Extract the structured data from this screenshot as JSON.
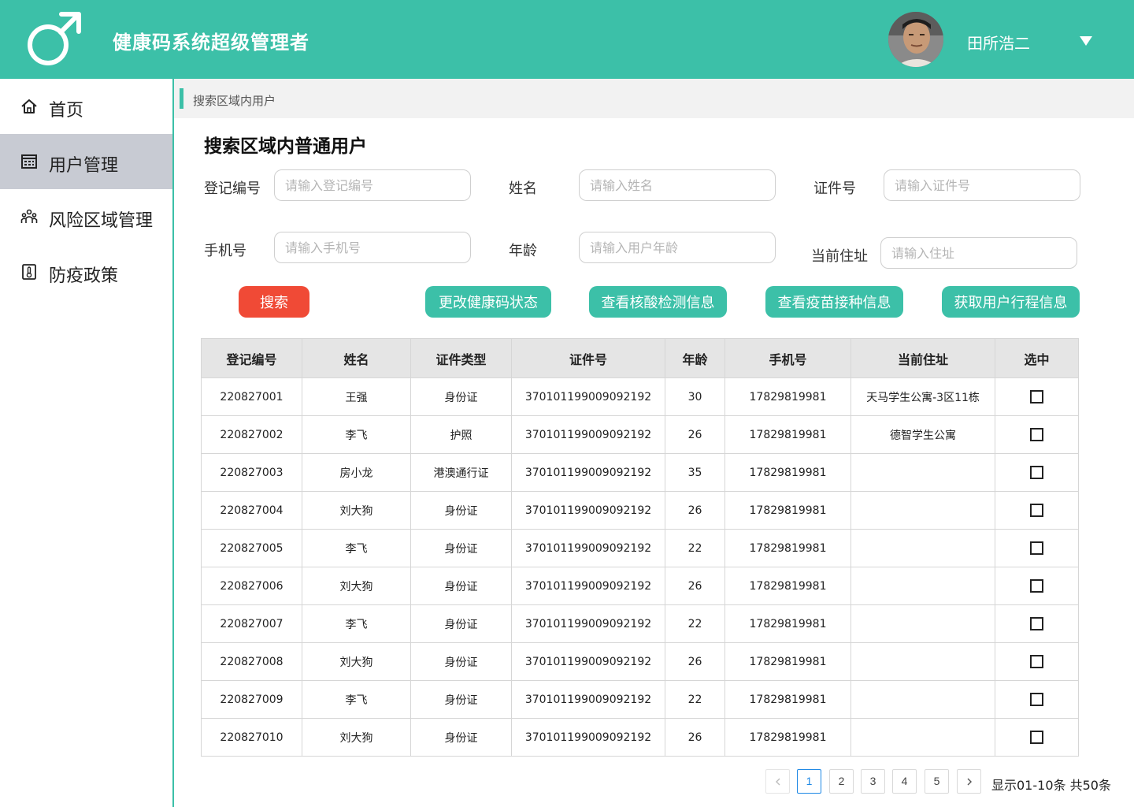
{
  "header": {
    "app_title": "健康码系统超级管理者",
    "user_name": "田所浩二",
    "logo_icon": "male-symbol-icon",
    "dropdown_icon": "caret-down-icon",
    "accent_color": "#3cc0a8"
  },
  "sidebar": {
    "items": [
      {
        "label": "首页",
        "icon": "home-icon",
        "active": false
      },
      {
        "label": "用户管理",
        "icon": "calendar-grid-icon",
        "active": true
      },
      {
        "label": "风险区域管理",
        "icon": "people-group-icon",
        "active": false
      },
      {
        "label": "防疫政策",
        "icon": "thermometer-icon",
        "active": false
      }
    ]
  },
  "breadcrumb": {
    "text": "搜索区域内用户"
  },
  "main": {
    "title": "搜索区域内普通用户",
    "form": {
      "reg_no": {
        "label": "登记编号",
        "placeholder": "请输入登记编号"
      },
      "name": {
        "label": "姓名",
        "placeholder": "请输入姓名"
      },
      "id_no": {
        "label": "证件号",
        "placeholder": "请输入证件号"
      },
      "phone": {
        "label": "手机号",
        "placeholder": "请输入手机号"
      },
      "age": {
        "label": "年龄",
        "placeholder": "请输入用户年龄"
      },
      "address": {
        "label": "当前住址",
        "placeholder": "请输入住址"
      }
    },
    "buttons": {
      "search": "搜索",
      "change_code": "更改健康码状态",
      "nucleic": "查看核酸检测信息",
      "vaccine": "查看疫苗接种信息",
      "itinerary": "获取用户行程信息"
    },
    "table": {
      "columns": [
        "登记编号",
        "姓名",
        "证件类型",
        "证件号",
        "年龄",
        "手机号",
        "当前住址",
        "选中"
      ],
      "rows": [
        {
          "reg": "220827001",
          "name": "王强",
          "type": "身份证",
          "id": "370101199009092192",
          "age": "30",
          "phone": "17829819981",
          "addr": "天马学生公寓-3区11栋"
        },
        {
          "reg": "220827002",
          "name": "李飞",
          "type": "护照",
          "id": "370101199009092192",
          "age": "26",
          "phone": "17829819981",
          "addr": "德智学生公寓"
        },
        {
          "reg": "220827003",
          "name": "房小龙",
          "type": "港澳通行证",
          "id": "370101199009092192",
          "age": "35",
          "phone": "17829819981",
          "addr": ""
        },
        {
          "reg": "220827004",
          "name": "刘大狗",
          "type": "身份证",
          "id": "370101199009092192",
          "age": "26",
          "phone": "17829819981",
          "addr": ""
        },
        {
          "reg": "220827005",
          "name": "李飞",
          "type": "身份证",
          "id": "370101199009092192",
          "age": "22",
          "phone": "17829819981",
          "addr": ""
        },
        {
          "reg": "220827006",
          "name": "刘大狗",
          "type": "身份证",
          "id": "370101199009092192",
          "age": "26",
          "phone": "17829819981",
          "addr": ""
        },
        {
          "reg": "220827007",
          "name": "李飞",
          "type": "身份证",
          "id": "370101199009092192",
          "age": "22",
          "phone": "17829819981",
          "addr": ""
        },
        {
          "reg": "220827008",
          "name": "刘大狗",
          "type": "身份证",
          "id": "370101199009092192",
          "age": "26",
          "phone": "17829819981",
          "addr": ""
        },
        {
          "reg": "220827009",
          "name": "李飞",
          "type": "身份证",
          "id": "370101199009092192",
          "age": "22",
          "phone": "17829819981",
          "addr": ""
        },
        {
          "reg": "220827010",
          "name": "刘大狗",
          "type": "身份证",
          "id": "370101199009092192",
          "age": "26",
          "phone": "17829819981",
          "addr": ""
        }
      ]
    },
    "pagination": {
      "pages": [
        "1",
        "2",
        "3",
        "4",
        "5"
      ],
      "current": "1",
      "prev_icon": "chevron-left-icon",
      "next_icon": "chevron-right-icon",
      "info": "显示01-10条  共50条"
    }
  }
}
